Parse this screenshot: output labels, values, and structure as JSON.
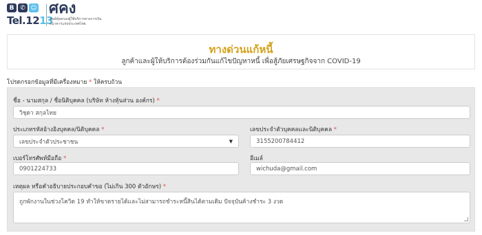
{
  "logo": {
    "icon_b": "B",
    "icon_phone": "✆",
    "icon_smile": "☺",
    "tel_prefix": "Tel.",
    "tel_num1": "12",
    "tel_num2": "13",
    "brand": "ศคง",
    "subtitle_line1": "ศูนย์คุ้มครองผู้ใช้บริการทางการเงิน",
    "subtitle_line2": "ธนาคารแห่งประเทศไทย"
  },
  "banner": {
    "title": "ทางด่วนแก้หนี้",
    "subtitle": "ลูกค้าและผู้ให้บริการต้องร่วมกันแก้ไขปัญหาหนี้ เพื่อสู้ภัยเศรษฐกิจจาก COVID-19"
  },
  "note": {
    "text": "โปรดกรอกข้อมูลที่มีเครื่องหมาย",
    "asterisk": "*",
    "suffix": "ให้ครบถ้วน"
  },
  "form": {
    "name_label": "ชื่อ - นามสกุล / ชื่อนิติบุคคล (บริษัท ห้างหุ้นส่วน องค์กร)",
    "name_value": "วิชุดา สกุลไทย",
    "id_type_label": "ประเภทรหัสอ้างอิงบุคคล/นิติบุคคล",
    "id_type_value": "เลขประจำตัวประชาชน",
    "id_number_label": "เลขประจำตัวบุคคลและนิติบุคคล",
    "id_number_value": "3155200784412",
    "phone_label": "เบอร์โทรศัพท์มือถือ",
    "phone_value": "0901224733",
    "email_label": "อีเมล์",
    "email_value": "wichuda@gmail.com",
    "reason_label": "เหตุผล หรือคำอธิบายประกอบคำขอ (ไม่เกิน 300 ตัวอักษร)",
    "reason_value": "ถูกพักงานในช่วงโควิด 19 ทำให้ขาดรายได้และไม่สามารถชำระหนี้สินได้ตามเดิม ปัจจุบันค้างชำระ 3 งวด",
    "required_mark": "*"
  },
  "colors": {
    "title_gold": "#d4a017",
    "required_red": "#d9534f",
    "panel_gray": "#e8e8e8",
    "brand_navy": "#2d3a5a",
    "brand_cyan": "#5bc0eb"
  }
}
